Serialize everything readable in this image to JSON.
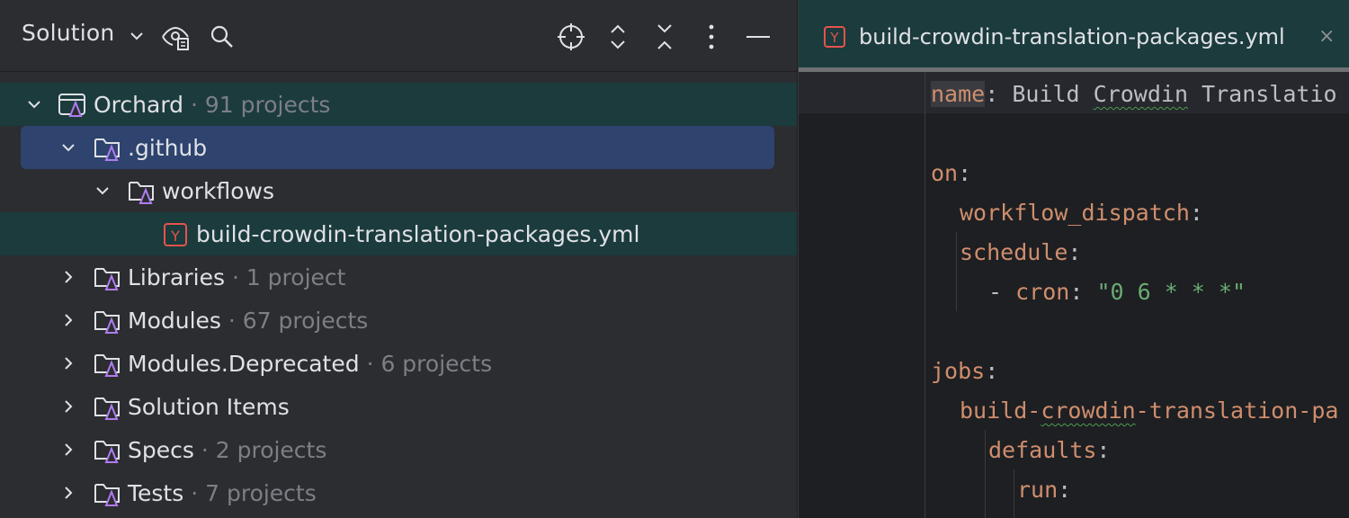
{
  "panel": {
    "title": "Solution",
    "tree": [
      {
        "label": "Orchard",
        "count": "· 91 projects",
        "expanded": true,
        "level": 0,
        "icon": "solution-icon"
      },
      {
        "label": ".github",
        "count": "",
        "expanded": true,
        "level": 1,
        "icon": "folder-icon"
      },
      {
        "label": "workflows",
        "count": "",
        "expanded": true,
        "level": 2,
        "icon": "folder-icon"
      },
      {
        "label": "build-crowdin-translation-packages.yml",
        "count": "",
        "level": 3,
        "icon": "yaml-file-icon"
      },
      {
        "label": "Libraries",
        "count": "· 1 project",
        "expanded": false,
        "level": 1,
        "icon": "folder-icon"
      },
      {
        "label": "Modules",
        "count": "· 67 projects",
        "expanded": false,
        "level": 1,
        "icon": "folder-icon"
      },
      {
        "label": "Modules.Deprecated",
        "count": "· 6 projects",
        "expanded": false,
        "level": 1,
        "icon": "folder-icon"
      },
      {
        "label": "Solution Items",
        "count": "",
        "expanded": false,
        "level": 1,
        "icon": "folder-icon"
      },
      {
        "label": "Specs",
        "count": "· 2 projects",
        "expanded": false,
        "level": 1,
        "icon": "folder-icon"
      },
      {
        "label": "Tests",
        "count": "· 7 projects",
        "expanded": false,
        "level": 1,
        "icon": "folder-icon"
      }
    ]
  },
  "editor": {
    "tab": {
      "label": "build-crowdin-translation-packages.yml",
      "close": "×",
      "icon_letter": "Y"
    },
    "lines": {
      "l1_key": "name",
      "l1_colon": ":",
      "l1_val_a": " Build ",
      "l1_val_b": "Crowdin",
      "l1_val_c": " Translatio",
      "l2_key": "on",
      "l2_colon": ":",
      "l3_key": "workflow_dispatch",
      "l3_colon": ":",
      "l4_key": "schedule",
      "l4_colon": ":",
      "l5_dash": "- ",
      "l5_key": "cron",
      "l5_colon": ": ",
      "l5_val": "\"0 6 * * *\"",
      "l6_key": "jobs",
      "l6_colon": ":",
      "l7_key_a": "build-",
      "l7_key_b": "crowdin",
      "l7_key_c": "-translation-pa",
      "l8_key": "defaults",
      "l8_colon": ":",
      "l9_key": "run",
      "l9_colon": ":"
    }
  },
  "colors": {
    "accent_row": "#1c3b3c",
    "selection": "#2e436e",
    "keyword": "#cf8e6d",
    "string": "#6aab73"
  }
}
